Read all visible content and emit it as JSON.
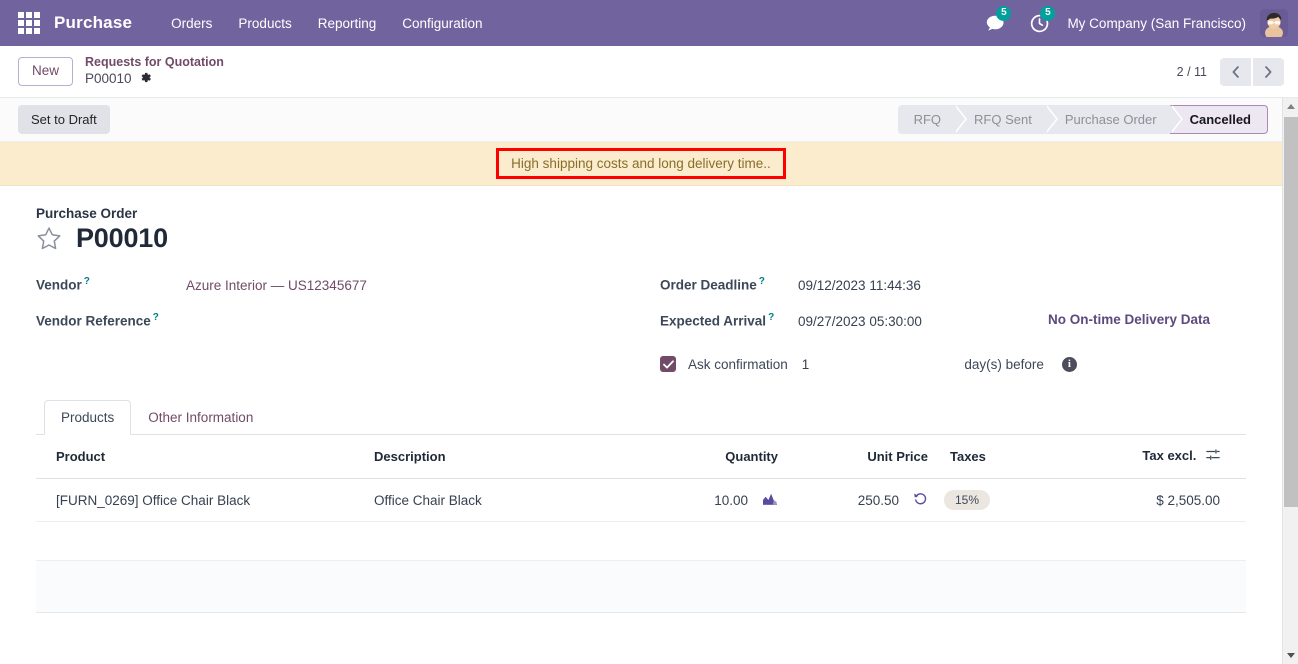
{
  "navbar": {
    "apps_icon": "apps-grid-icon",
    "brand": "Purchase",
    "menu": [
      {
        "label": "Orders"
      },
      {
        "label": "Products"
      },
      {
        "label": "Reporting"
      },
      {
        "label": "Configuration"
      }
    ],
    "messages_icon": "chat-bubble-icon",
    "messages_count": "5",
    "activities_icon": "clock-icon",
    "activities_count": "5",
    "company": "My Company (San Francisco)",
    "avatar_icon": "user-avatar",
    "background_color": "#71639e",
    "badge_color": "#00a09d"
  },
  "control_panel": {
    "new_label": "New",
    "breadcrumb_parent": "Requests for Quotation",
    "breadcrumb_current": "P00010",
    "settings_icon": "gear-icon",
    "pager_text": "2 / 11",
    "prev_icon": "chevron-left-icon",
    "next_icon": "chevron-right-icon"
  },
  "statusbar": {
    "set_to_draft": "Set to Draft",
    "steps": [
      {
        "label": "RFQ",
        "active": false
      },
      {
        "label": "RFQ Sent",
        "active": false
      },
      {
        "label": "Purchase Order",
        "active": false
      },
      {
        "label": "Cancelled",
        "active": true
      }
    ]
  },
  "alert": {
    "message": "High shipping costs and long delivery time..",
    "highlight_color": "#ff0000",
    "background_color": "#faeccd",
    "text_color": "#8a6d2a"
  },
  "form": {
    "title_label": "Purchase Order",
    "record_id": "P00010",
    "star_icon": "star-outline-icon",
    "left_fields": [
      {
        "label": "Vendor",
        "help": "?",
        "value": "Azure Interior — US12345677",
        "is_link": true
      },
      {
        "label": "Vendor Reference",
        "help": "?",
        "value": "",
        "is_link": false
      }
    ],
    "right_fields": [
      {
        "label": "Order Deadline",
        "help": "?",
        "value": "09/12/2023 11:44:36"
      },
      {
        "label": "Expected Arrival",
        "help": "?",
        "value": "09/27/2023 05:30:00"
      }
    ],
    "ontime_link": "No On-time Delivery Data",
    "ask_confirmation": {
      "checked": true,
      "label": "Ask confirmation",
      "days": "1",
      "unit": "day(s) before",
      "info_icon": "info-icon",
      "info_glyph": "i"
    }
  },
  "notebook": {
    "tabs": [
      {
        "label": "Products",
        "active": true
      },
      {
        "label": "Other Information",
        "active": false
      }
    ]
  },
  "lines_table": {
    "columns": [
      "Product",
      "Description",
      "Quantity",
      "Unit Price",
      "Taxes",
      "Tax excl."
    ],
    "optional_columns_icon": "column-options-icon",
    "rows": [
      {
        "product": "[FURN_0269] Office Chair Black",
        "description": "Office Chair Black",
        "quantity": "10.00",
        "quantity_icon": "area-chart-icon",
        "unit_price": "250.50",
        "unit_price_icon": "history-icon",
        "taxes": "15%",
        "subtotal": "$ 2,505.00"
      }
    ]
  },
  "scrollbar": {
    "up_icon": "scroll-up-arrow",
    "down_icon": "scroll-down-arrow"
  }
}
